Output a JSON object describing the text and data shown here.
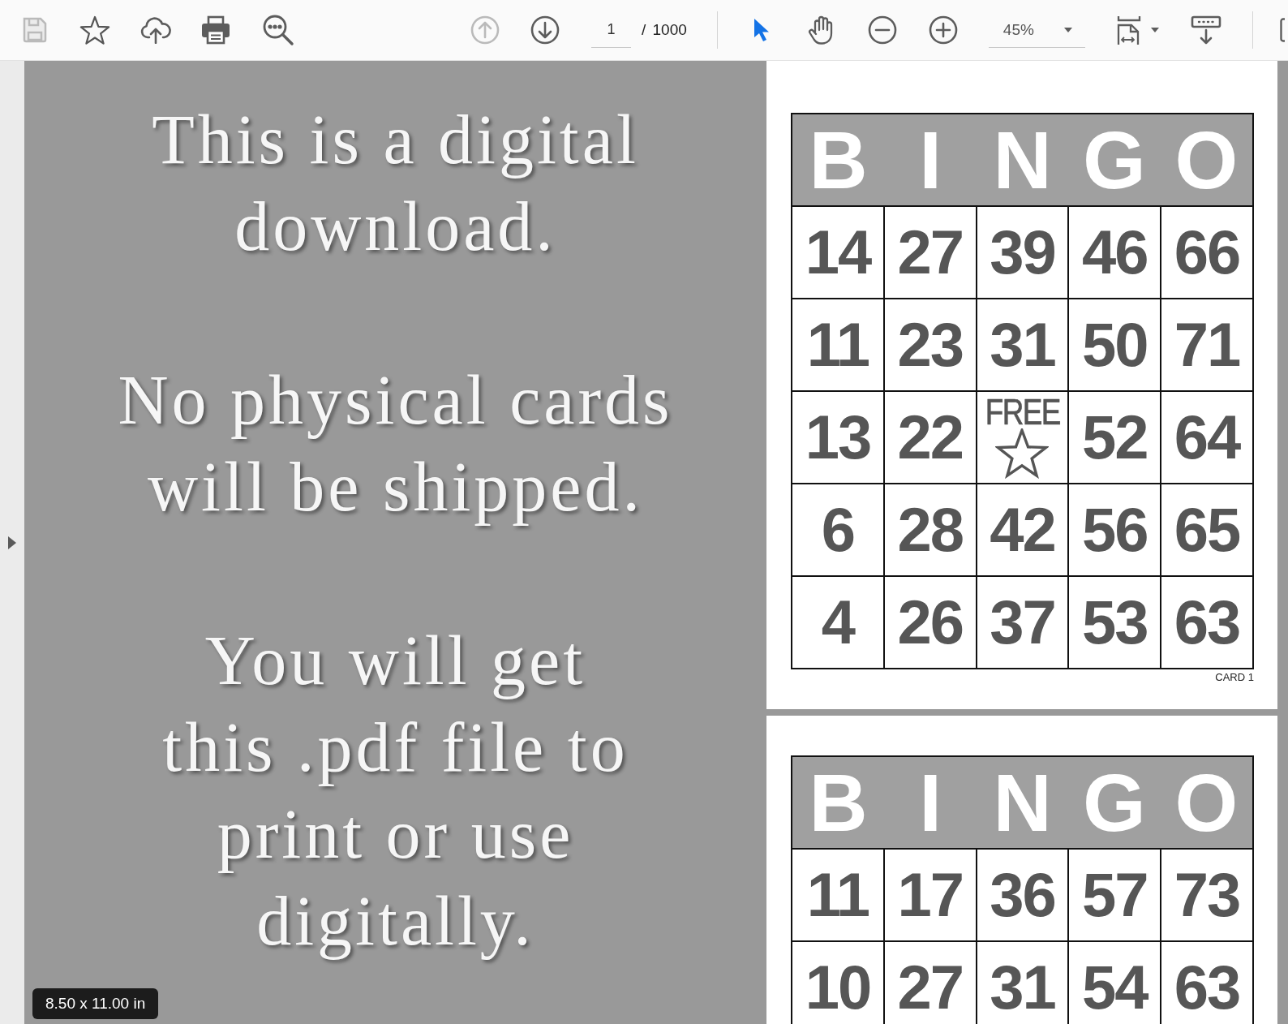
{
  "toolbar": {
    "save": {
      "disabled": true
    },
    "previous_page": {
      "disabled": true
    },
    "next_page": {
      "disabled": false
    },
    "page_field": {
      "value": "1"
    },
    "page_total": "/ 1000",
    "tools": [
      {
        "kind": "select",
        "selected": true
      },
      {
        "kind": "hand",
        "selected": false
      }
    ],
    "zoom_field": {
      "value": "45%"
    }
  },
  "notice": {
    "paragraphs": [
      {
        "lines": [
          "This is a digital",
          "download."
        ]
      },
      {
        "lines": [
          "No physical cards",
          "will be shipped."
        ]
      },
      {
        "lines": [
          "You will get",
          "this .pdf file to",
          "print or use",
          "digitally."
        ]
      }
    ]
  },
  "page_size": "8.50 x 11.00 in",
  "pages": [
    {
      "card": {
        "letters": [
          "B",
          "I",
          "N",
          "G",
          "O"
        ],
        "rows": [
          [
            {
              "kind": "number",
              "text": "14"
            },
            {
              "kind": "number",
              "text": "27"
            },
            {
              "kind": "number",
              "text": "39"
            },
            {
              "kind": "number",
              "text": "46"
            },
            {
              "kind": "number",
              "text": "66"
            }
          ],
          [
            {
              "kind": "number",
              "text": "11"
            },
            {
              "kind": "number",
              "text": "23"
            },
            {
              "kind": "number",
              "text": "31"
            },
            {
              "kind": "number",
              "text": "50"
            },
            {
              "kind": "number",
              "text": "71"
            }
          ],
          [
            {
              "kind": "number",
              "text": "13"
            },
            {
              "kind": "number",
              "text": "22"
            },
            {
              "kind": "free",
              "text": "FREE"
            },
            {
              "kind": "number",
              "text": "52"
            },
            {
              "kind": "number",
              "text": "64"
            }
          ],
          [
            {
              "kind": "number",
              "text": "6"
            },
            {
              "kind": "number",
              "text": "28"
            },
            {
              "kind": "number",
              "text": "42"
            },
            {
              "kind": "number",
              "text": "56"
            },
            {
              "kind": "number",
              "text": "65"
            }
          ],
          [
            {
              "kind": "number",
              "text": "4"
            },
            {
              "kind": "number",
              "text": "26"
            },
            {
              "kind": "number",
              "text": "37"
            },
            {
              "kind": "number",
              "text": "53"
            },
            {
              "kind": "number",
              "text": "63"
            }
          ]
        ],
        "label": "CARD 1"
      }
    },
    {
      "card": {
        "letters": [
          "B",
          "I",
          "N",
          "G",
          "O"
        ],
        "rows": [
          [
            {
              "kind": "number",
              "text": "11"
            },
            {
              "kind": "number",
              "text": "17"
            },
            {
              "kind": "number",
              "text": "36"
            },
            {
              "kind": "number",
              "text": "57"
            },
            {
              "kind": "number",
              "text": "73"
            }
          ],
          [
            {
              "kind": "number",
              "text": "10"
            },
            {
              "kind": "number",
              "text": "27"
            },
            {
              "kind": "number",
              "text": "31"
            },
            {
              "kind": "number",
              "text": "54"
            },
            {
              "kind": "number",
              "text": "63"
            }
          ]
        ]
      }
    }
  ]
}
